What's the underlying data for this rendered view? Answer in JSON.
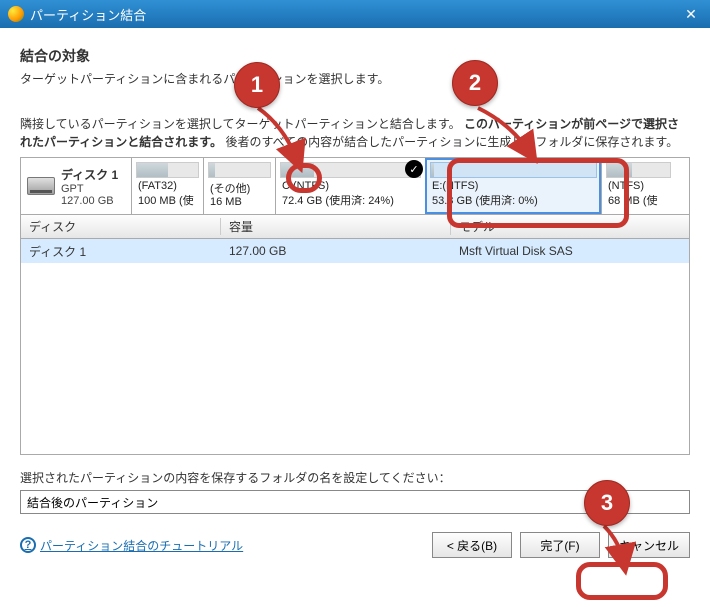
{
  "titlebar": {
    "title": "パーティション結合"
  },
  "header": {
    "title": "結合の対象",
    "subtitle": "ターゲットパーティションに含まれるパーティションを選択します。"
  },
  "instruction": {
    "prefix": "隣接しているパーティションを選択してターゲットパーティションと結合します。",
    "bold": "このパーティションが前ページで選択されたパーティションと結合されます。",
    "suffix": "後者のすべての内容が結合したパーティションに生成したフォルダに保存されます。"
  },
  "disk": {
    "name": "ディスク 1",
    "type": "GPT",
    "size": "127.00 GB"
  },
  "partitions": [
    {
      "name": "(FAT32)",
      "size": "100 MB (使",
      "width": 72,
      "fill": 50
    },
    {
      "name": "(その他)",
      "size": "16 MB",
      "width": 72,
      "fill": 10
    },
    {
      "name": "C:(NTFS)",
      "size": "72.4 GB (使用済: 24%)",
      "width": 150,
      "fill": 24,
      "checked": true
    },
    {
      "name": "E:(NTFS)",
      "size": "53.8 GB (使用済: 0%)",
      "width": 176,
      "fill": 2,
      "selected": true
    },
    {
      "name": "(NTFS)",
      "size": "68 MB (使",
      "width": 74,
      "fill": 40
    }
  ],
  "table": {
    "headers": {
      "disk": "ディスク",
      "capacity": "容量",
      "model": "モデル"
    },
    "rows": [
      {
        "disk": "ディスク 1",
        "capacity": "127.00 GB",
        "model": "Msft Virtual Disk SAS"
      }
    ]
  },
  "folder": {
    "label": "選択されたパーティションの内容を保存するフォルダの名を設定してください：",
    "value": "結合後のパーティション"
  },
  "help": {
    "text": "パーティション結合のチュートリアル"
  },
  "buttons": {
    "back": "< 戻る(B)",
    "finish": "完了(F)",
    "cancel": "キャンセル"
  },
  "annotations": {
    "b1": "1",
    "b2": "2",
    "b3": "3"
  }
}
